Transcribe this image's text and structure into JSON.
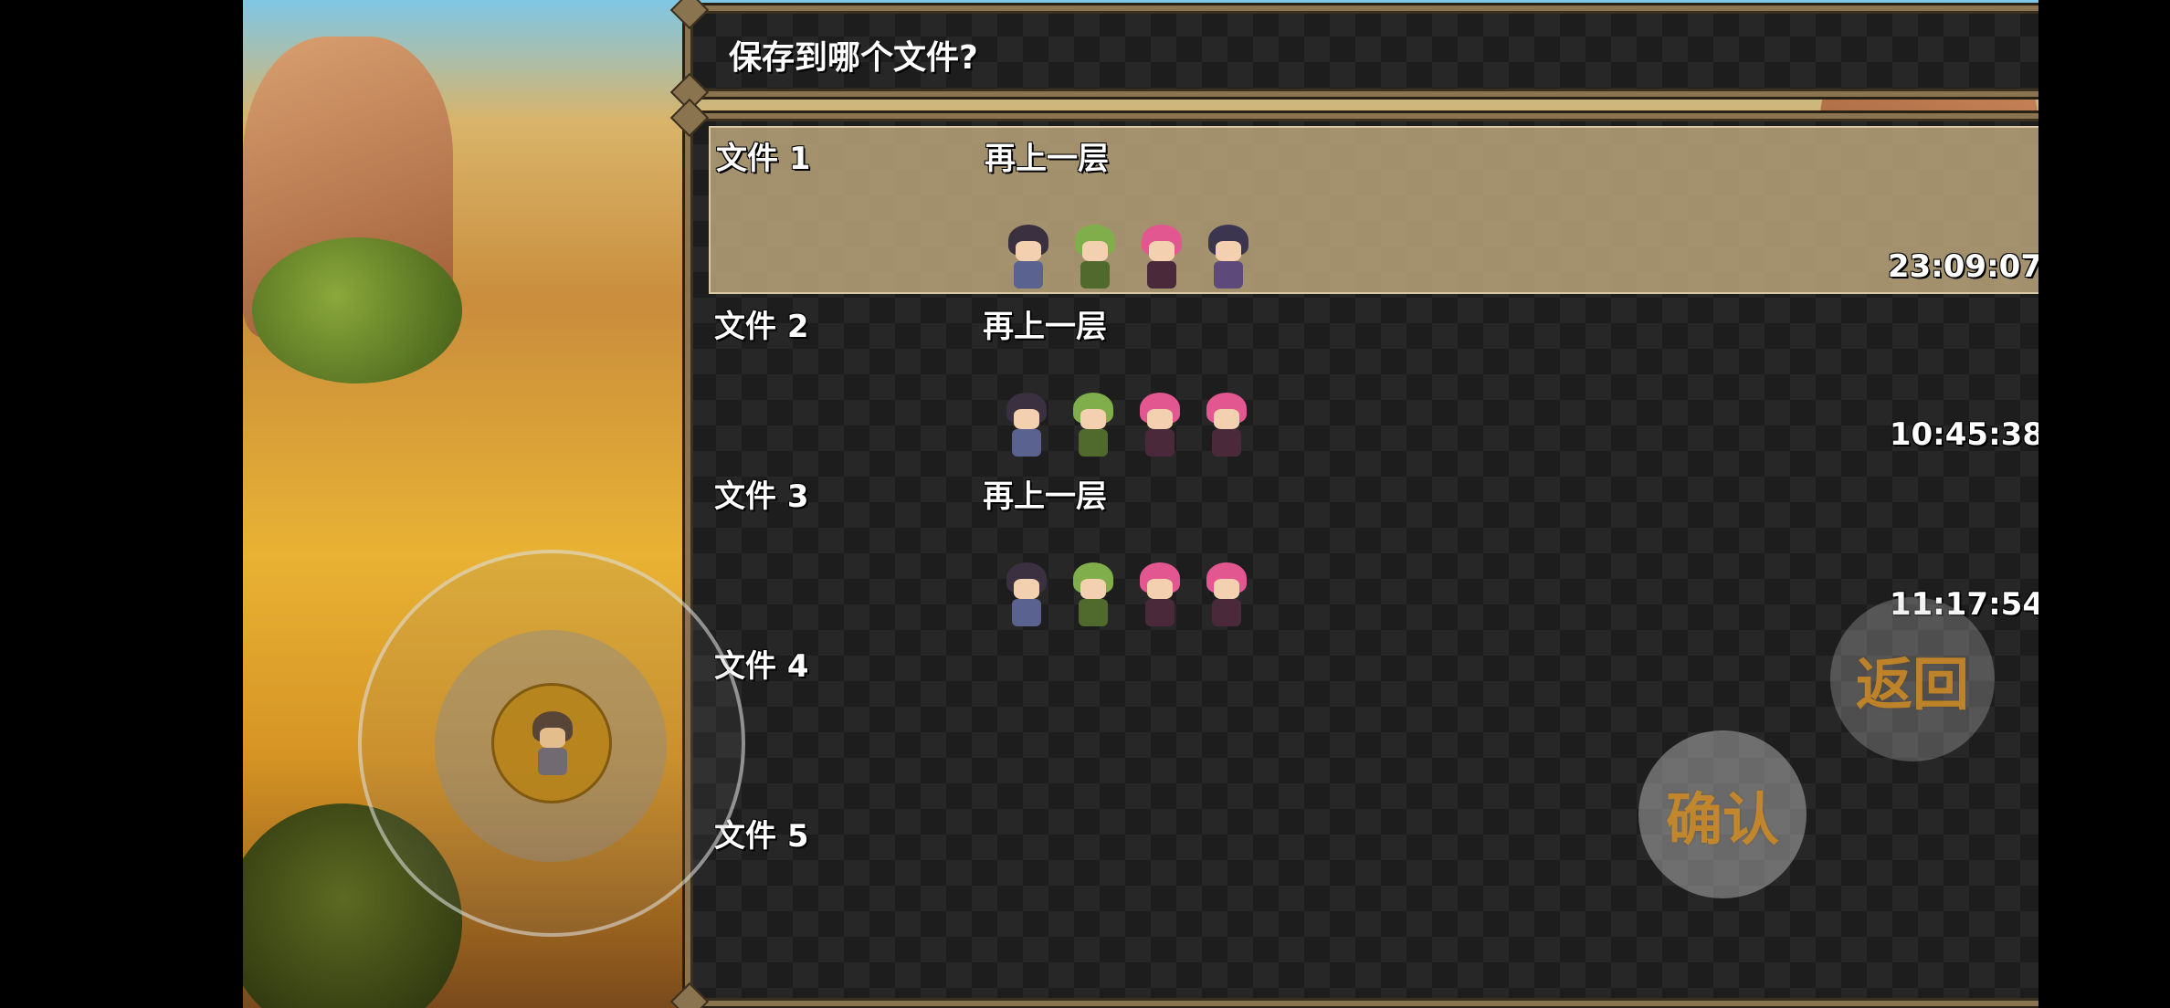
{
  "help": {
    "text": "保存到哪个文件?"
  },
  "slots": [
    {
      "label": "文件 1",
      "location": "再上一层",
      "playtime": "23:09:07",
      "selected": true,
      "party": [
        "hero-sprite",
        "green-haired-ally-sprite",
        "pink-haired-ally-sprite",
        "dark-haired-ally-sprite"
      ]
    },
    {
      "label": "文件 2",
      "location": "再上一层",
      "playtime": "10:45:38",
      "selected": false,
      "party": [
        "hero-sprite",
        "green-haired-ally-sprite",
        "pink-haired-ally-sprite",
        "pink-haired-ally-sprite"
      ]
    },
    {
      "label": "文件 3",
      "location": "再上一层",
      "playtime": "11:17:54",
      "selected": false,
      "party": [
        "hero-sprite",
        "green-haired-ally-sprite",
        "pink-haired-ally-sprite",
        "pink-haired-ally-sprite"
      ]
    },
    {
      "label": "文件 4",
      "location": "",
      "playtime": "",
      "selected": false,
      "party": []
    },
    {
      "label": "文件 5",
      "location": "",
      "playtime": "",
      "selected": false,
      "party": []
    }
  ],
  "controls": {
    "back_label": "返回",
    "confirm_label": "确认",
    "joystick_icon": "hero-sprite"
  },
  "colors": {
    "frame": "#8a7450",
    "window_bg": "#1d1d1d",
    "selection": "#d6bc8c",
    "button_text": "#dc9628"
  }
}
